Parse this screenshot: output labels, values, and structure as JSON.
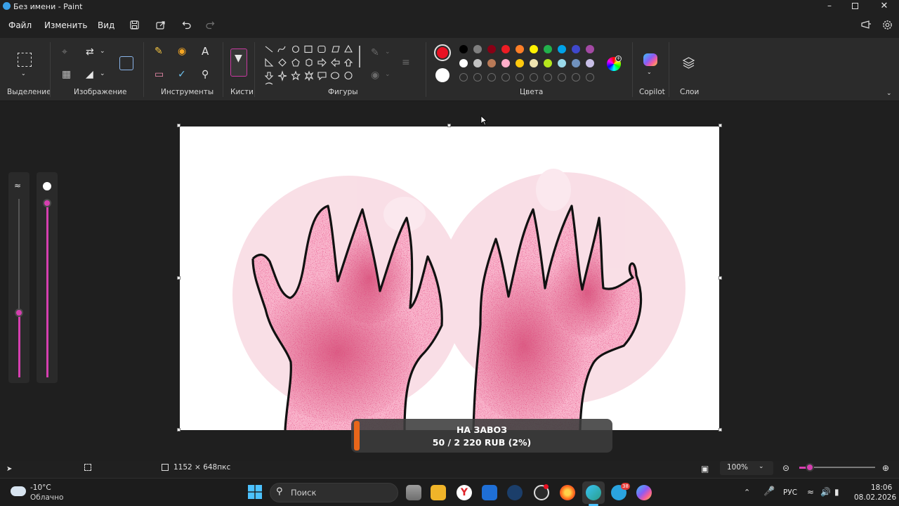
{
  "window": {
    "title": "Без имени - Paint"
  },
  "menu": {
    "file": "Файл",
    "edit": "Изменить",
    "view": "Вид"
  },
  "ribbon": {
    "groups": {
      "selection": "Выделение",
      "image": "Изображение",
      "tools": "Инструменты",
      "brushes": "Кисти",
      "shapes": "Фигуры",
      "colors": "Цвета",
      "copilot": "Copilot",
      "layers": "Слои"
    },
    "tools_text_icon": "A"
  },
  "colors": {
    "primary": "#e81123",
    "secondary": "#ffffff",
    "palette_row1": [
      "#000000",
      "#7f7f7f",
      "#880015",
      "#ed1c24",
      "#ff7f27",
      "#fff200",
      "#22b14c",
      "#00a2e8",
      "#3f48cc",
      "#a349a4"
    ],
    "palette_row2": [
      "#ffffff",
      "#c3c3c3",
      "#b97a57",
      "#ffaec9",
      "#ffc90e",
      "#efe4b0",
      "#b5e61d",
      "#99d9ea",
      "#7092be",
      "#c8bfe7"
    ]
  },
  "status": {
    "canvas_size": "1152 × 648пкс",
    "zoom": "100%"
  },
  "overlay": {
    "title": "НА ЗАВОЗ",
    "progress_text": "50 / 2 220 RUB (2%)",
    "progress": 0.02
  },
  "taskbar": {
    "weather_temp": "-10°C",
    "weather_desc": "Облачно",
    "search_placeholder": "Поиск",
    "language": "РУС",
    "time": "18:06",
    "date": "08.02.2026",
    "telegram_badge": "38"
  }
}
